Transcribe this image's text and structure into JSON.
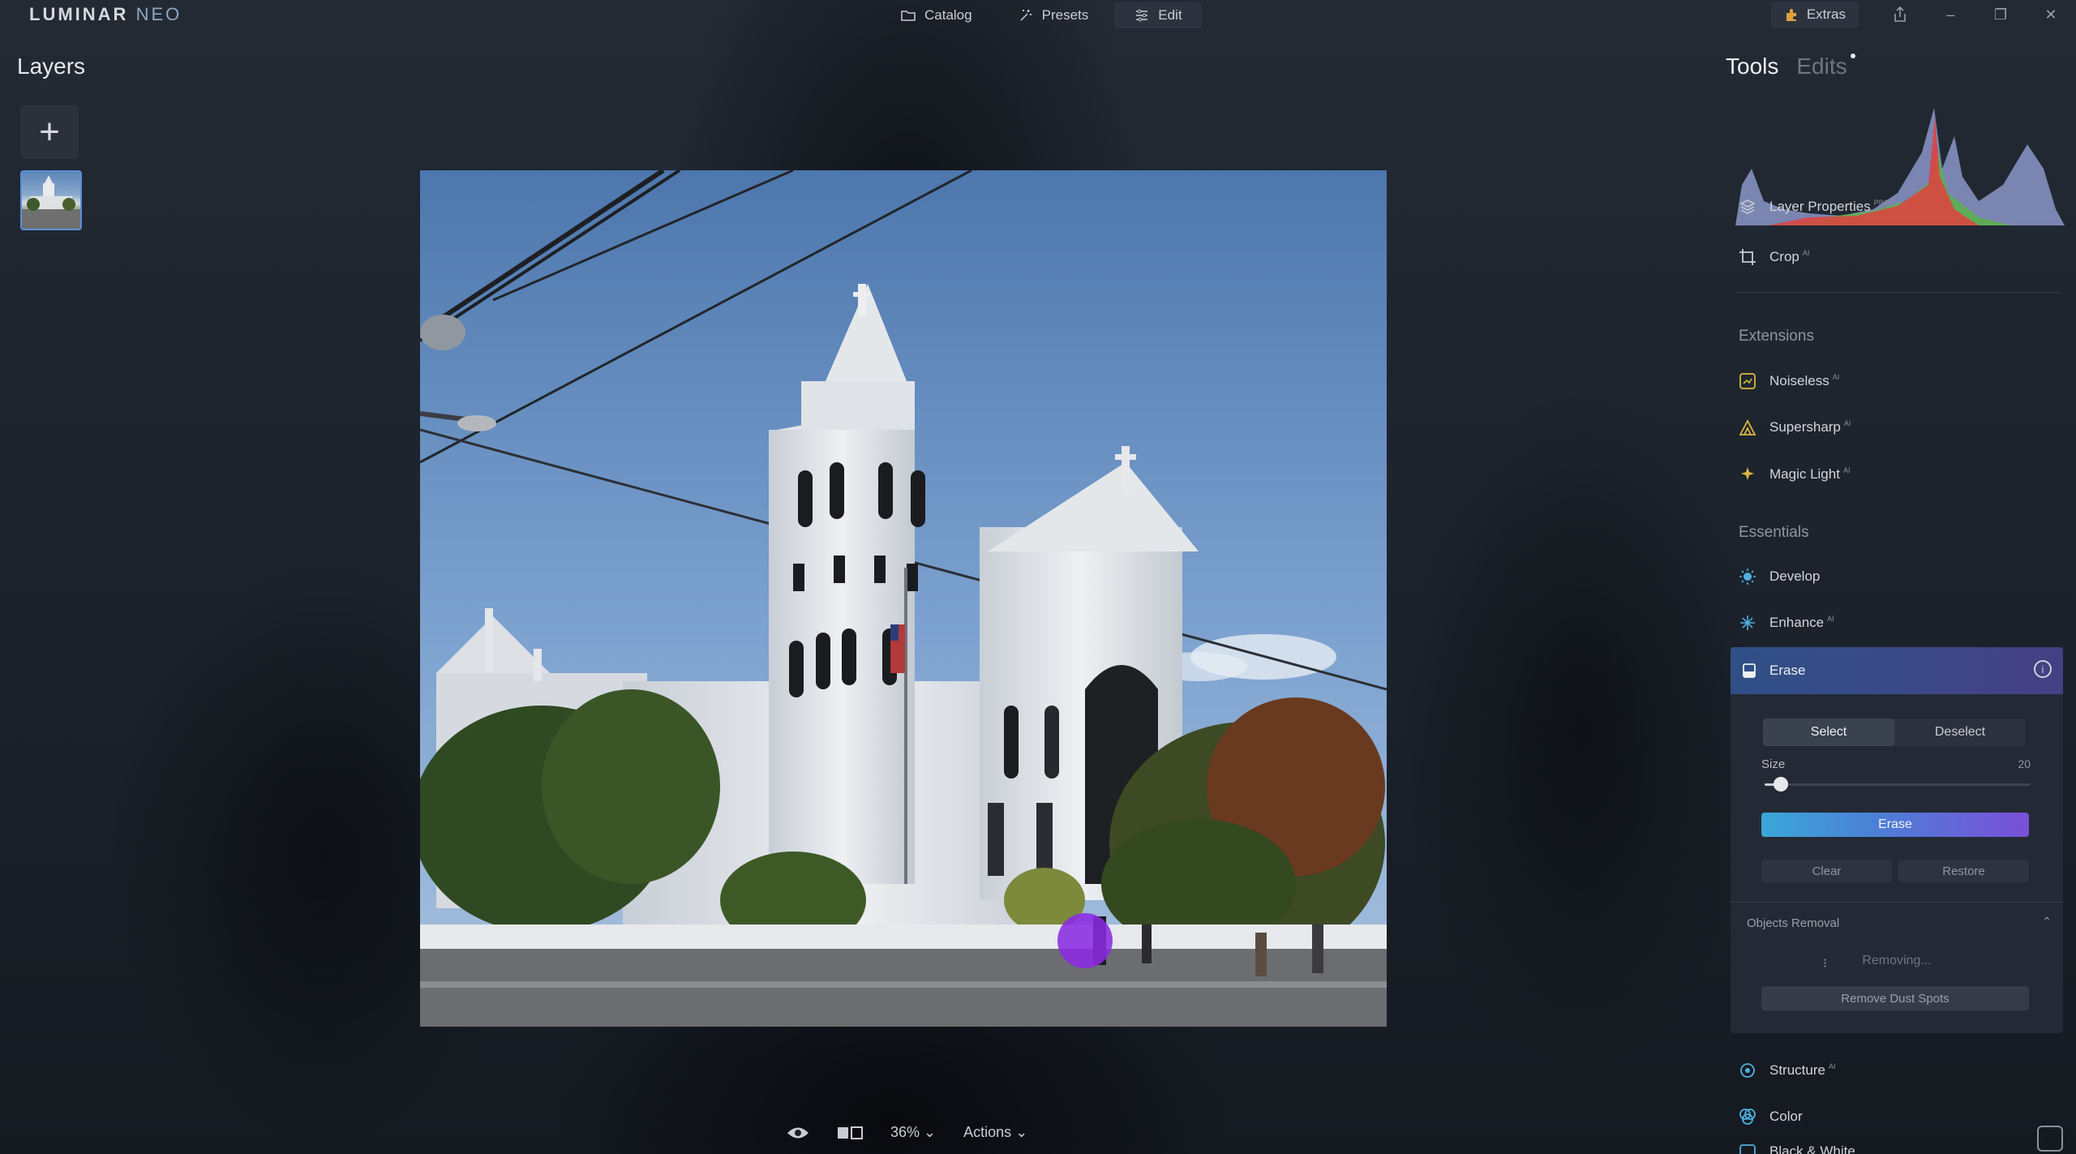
{
  "app": {
    "logo_main": "LUMINAR",
    "logo_sub": "NEO"
  },
  "nav": {
    "catalog": "Catalog",
    "presets": "Presets",
    "edit": "Edit"
  },
  "topright": {
    "extras": "Extras",
    "minimize": "–",
    "restore": "❐",
    "close": "✕"
  },
  "layers": {
    "title": "Layers",
    "add": "+"
  },
  "tabs": {
    "tools": "Tools",
    "edits": "Edits"
  },
  "tools": {
    "layer_properties": "Layer Properties",
    "layer_properties_badge": "PRO",
    "crop": "Crop",
    "crop_badge": "AI",
    "extensions_title": "Extensions",
    "noiseless": "Noiseless",
    "supersharp": "Supersharp",
    "magic_light": "Magic Light",
    "ai_badge": "AI",
    "essentials_title": "Essentials",
    "develop": "Develop",
    "enhance": "Enhance",
    "structure": "Structure",
    "color": "Color",
    "black_white": "Black & White"
  },
  "erase": {
    "title": "Erase",
    "info": "i",
    "select": "Select",
    "deselect": "Deselect",
    "size_label": "Size",
    "size_value": "20",
    "size_fraction": 0.2,
    "erase_button": "Erase",
    "clear": "Clear",
    "restore": "Restore",
    "objects_removal": "Objects Removal",
    "removing": "Removing...",
    "remove_dust": "Remove Dust Spots"
  },
  "bottom": {
    "zoom": "36%",
    "actions": "Actions"
  },
  "colors": {
    "accent_blue": "#3aa7d8",
    "accent_purple": "#7a4fd8",
    "brush": "#8b2be2"
  }
}
